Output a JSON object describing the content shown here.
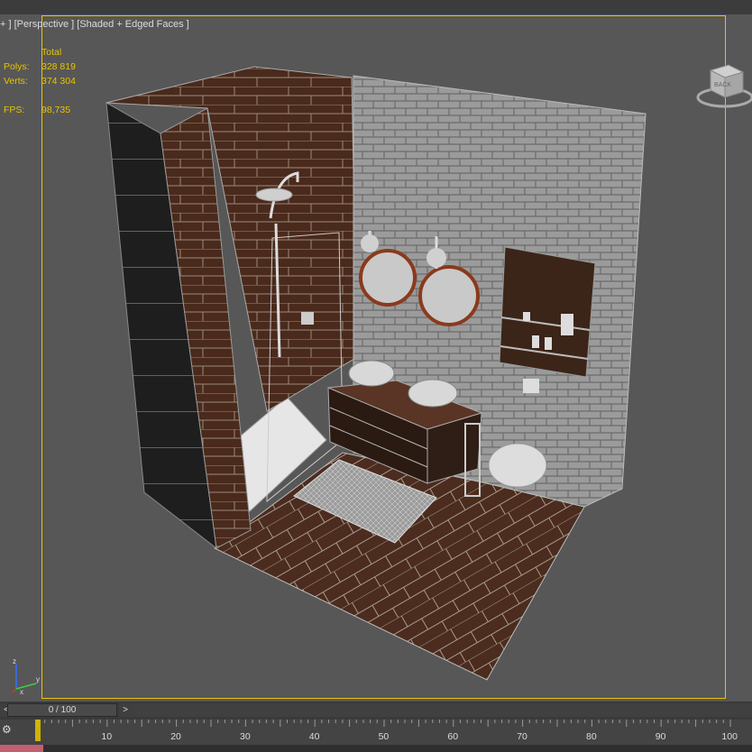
{
  "viewport": {
    "label": "+ ] [Perspective ] [Shaded + Edged Faces ]",
    "stats": {
      "header": "Total",
      "polys_label": "Polys:",
      "polys_value": "328 819",
      "verts_label": "Verts:",
      "verts_value": "374 304",
      "fps_label": "FPS:",
      "fps_value": "98,735"
    },
    "viewcube_face": "BACK",
    "axis": {
      "x": "x",
      "y": "y",
      "z": "z"
    }
  },
  "timeline": {
    "slider_label": "0 / 100",
    "prev": "<",
    "next": ">",
    "ticks": [
      "10",
      "20",
      "30",
      "40",
      "50",
      "60",
      "70",
      "80",
      "90",
      "100"
    ],
    "frame_position": 0
  },
  "colors": {
    "selection_border": "#e8c400",
    "stats_text": "#e8c400",
    "wood": "#4a2a1c",
    "brick": "#9a9a9a",
    "viewport_bg": "#575757"
  }
}
